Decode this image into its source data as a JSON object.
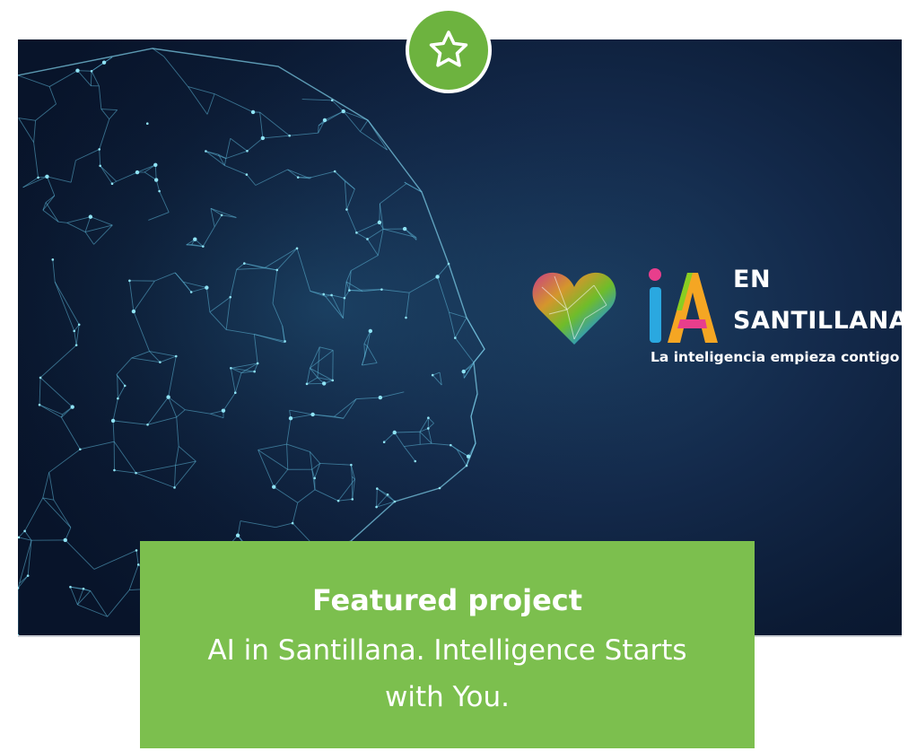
{
  "badge": {
    "icon": "star-icon",
    "color": "#6db33f"
  },
  "hero": {
    "image": "wireframe-head-image",
    "logo": {
      "line1": "EN",
      "line2": "SANTILLANA",
      "tagline": "La inteligencia empieza contigo"
    }
  },
  "caption": {
    "title": "Featured project",
    "body": "AI in Santillana. Intelligence Starts with You.",
    "background": "#7cbf4e"
  }
}
